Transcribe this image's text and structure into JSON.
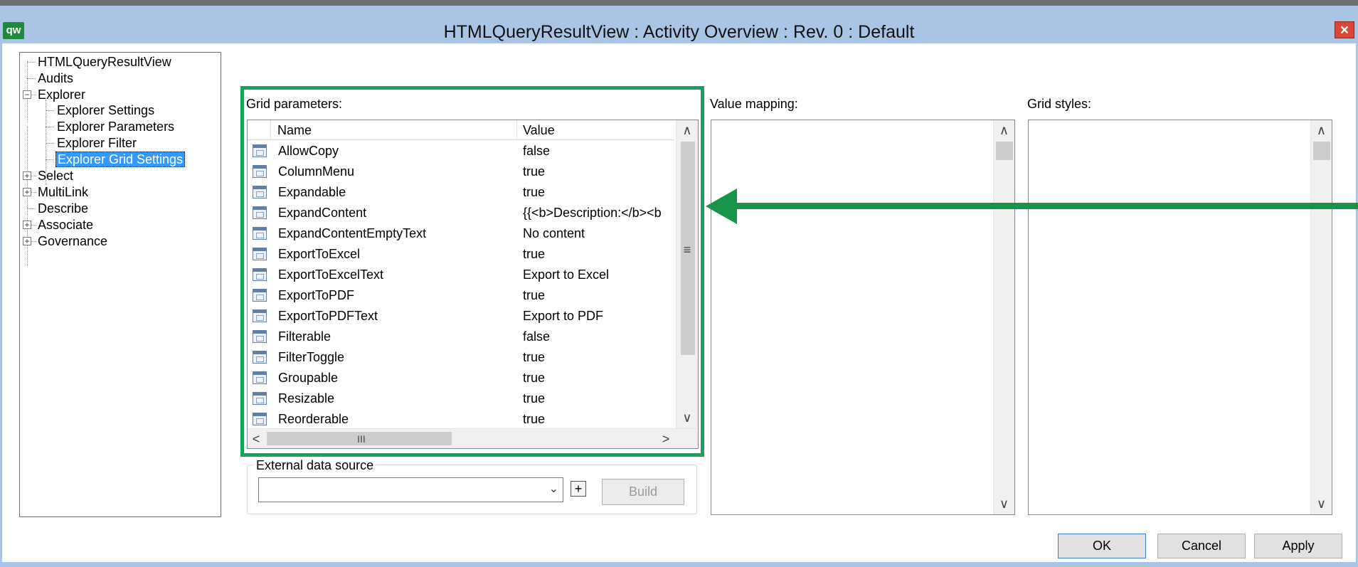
{
  "window": {
    "title": "HTMLQueryResultView : Activity Overview : Rev. 0  : Default",
    "app_icon": "qw",
    "close_label": "×"
  },
  "tree": {
    "items": [
      {
        "label": "HTMLQueryResultView",
        "level": 0,
        "expander": "none"
      },
      {
        "label": "Audits",
        "level": 0,
        "expander": "none"
      },
      {
        "label": "Explorer",
        "level": 0,
        "expander": "minus"
      },
      {
        "label": "Explorer Settings",
        "level": 1,
        "expander": "none"
      },
      {
        "label": "Explorer Parameters",
        "level": 1,
        "expander": "none"
      },
      {
        "label": "Explorer Filter",
        "level": 1,
        "expander": "none"
      },
      {
        "label": "Explorer Grid Settings",
        "level": 1,
        "expander": "none",
        "selected": true
      },
      {
        "label": "Select",
        "level": 0,
        "expander": "plus"
      },
      {
        "label": "MultiLink",
        "level": 0,
        "expander": "plus"
      },
      {
        "label": "Describe",
        "level": 0,
        "expander": "none"
      },
      {
        "label": "Associate",
        "level": 0,
        "expander": "plus"
      },
      {
        "label": "Governance",
        "level": 0,
        "expander": "plus"
      }
    ]
  },
  "grid_parameters": {
    "label": "Grid parameters:",
    "columns": [
      "Name",
      "Value"
    ],
    "rows": [
      {
        "name": "AllowCopy",
        "value": "false"
      },
      {
        "name": "ColumnMenu",
        "value": "true"
      },
      {
        "name": "Expandable",
        "value": "true"
      },
      {
        "name": "ExpandContent",
        "value": "{{<b>Description:</b><b"
      },
      {
        "name": "ExpandContentEmptyText",
        "value": "No content"
      },
      {
        "name": "ExportToExcel",
        "value": "true"
      },
      {
        "name": "ExportToExcelText",
        "value": "Export to Excel"
      },
      {
        "name": "ExportToPDF",
        "value": "true"
      },
      {
        "name": "ExportToPDFText",
        "value": "Export to PDF"
      },
      {
        "name": "Filterable",
        "value": "false"
      },
      {
        "name": "FilterToggle",
        "value": "true"
      },
      {
        "name": "Groupable",
        "value": "true"
      },
      {
        "name": "Resizable",
        "value": "true"
      },
      {
        "name": "Reorderable",
        "value": "true"
      }
    ]
  },
  "value_mapping": {
    "label": "Value mapping:"
  },
  "grid_styles": {
    "label": "Grid styles:"
  },
  "external_data_source": {
    "legend": "External data source",
    "value": "",
    "add_label": "+",
    "build_label": "Build"
  },
  "buttons": {
    "ok": "OK",
    "cancel": "Cancel",
    "apply": "Apply"
  },
  "icons": {
    "scroll_up": "∧",
    "scroll_down": "∨",
    "scroll_left": "<",
    "scroll_right": ">",
    "grip_vertical": "≡",
    "grip_horizontal": "III",
    "dropdown": "⌄"
  },
  "colors": {
    "titlebar": "#a9c4e4",
    "highlight_border": "#17a25a",
    "annotation_arrow": "#17934a",
    "selection": "#3399ff"
  }
}
